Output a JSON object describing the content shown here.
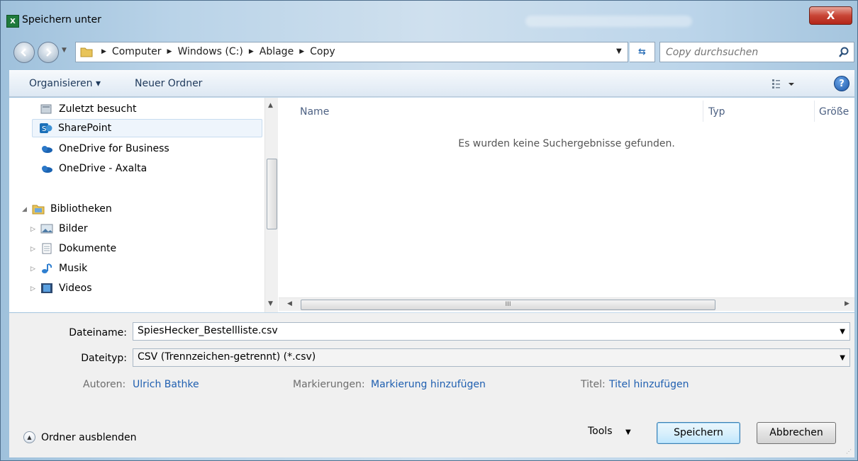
{
  "window": {
    "title": "Speichern unter",
    "app_icon": "excel-icon",
    "close_label": "X"
  },
  "address": {
    "crumbs": [
      "Computer",
      "Windows (C:)",
      "Ablage",
      "Copy"
    ],
    "search_placeholder": "Copy durchsuchen"
  },
  "toolbar": {
    "organize_label": "Organisieren ▾",
    "new_folder_label": "Neuer Ordner",
    "help_label": "?"
  },
  "nav": {
    "items": [
      {
        "label": "Zuletzt besucht",
        "icon": "recent-places-icon"
      },
      {
        "label": "SharePoint",
        "icon": "sharepoint-icon"
      },
      {
        "label": "OneDrive for Business",
        "icon": "onedrive-icon"
      },
      {
        "label": "OneDrive - Axalta",
        "icon": "onedrive-icon"
      },
      {
        "label": "Bibliotheken",
        "icon": "libraries-icon"
      },
      {
        "label": "Bilder",
        "icon": "pictures-icon"
      },
      {
        "label": "Dokumente",
        "icon": "documents-icon"
      },
      {
        "label": "Musik",
        "icon": "music-icon"
      },
      {
        "label": "Videos",
        "icon": "videos-icon"
      }
    ],
    "selected": "SharePoint"
  },
  "files": {
    "columns": [
      "Name",
      "Typ",
      "Größe"
    ],
    "empty_message": "Es wurden keine Suchergebnisse gefunden.",
    "scroll_grip": "III"
  },
  "form": {
    "filename_label": "Dateiname:",
    "filename_value": "SpiesHecker_Bestellliste.csv",
    "filetype_label": "Dateityp:",
    "filetype_value": "CSV (Trennzeichen-getrennt) (*.csv)",
    "authors_label": "Autoren:",
    "authors_value": "Ulrich Bathke",
    "tags_label": "Markierungen:",
    "tags_value": "Markierung hinzufügen",
    "title_label": "Titel:",
    "title_value": "Titel hinzufügen",
    "hide_folders_label": "Ordner ausblenden",
    "tools_label": "Tools",
    "save_label": "Speichern",
    "cancel_label": "Abbrechen"
  },
  "colors": {
    "accent_link": "#1f5fb0",
    "close_red": "#c94536",
    "frame_blue": "#b9d3e8"
  }
}
